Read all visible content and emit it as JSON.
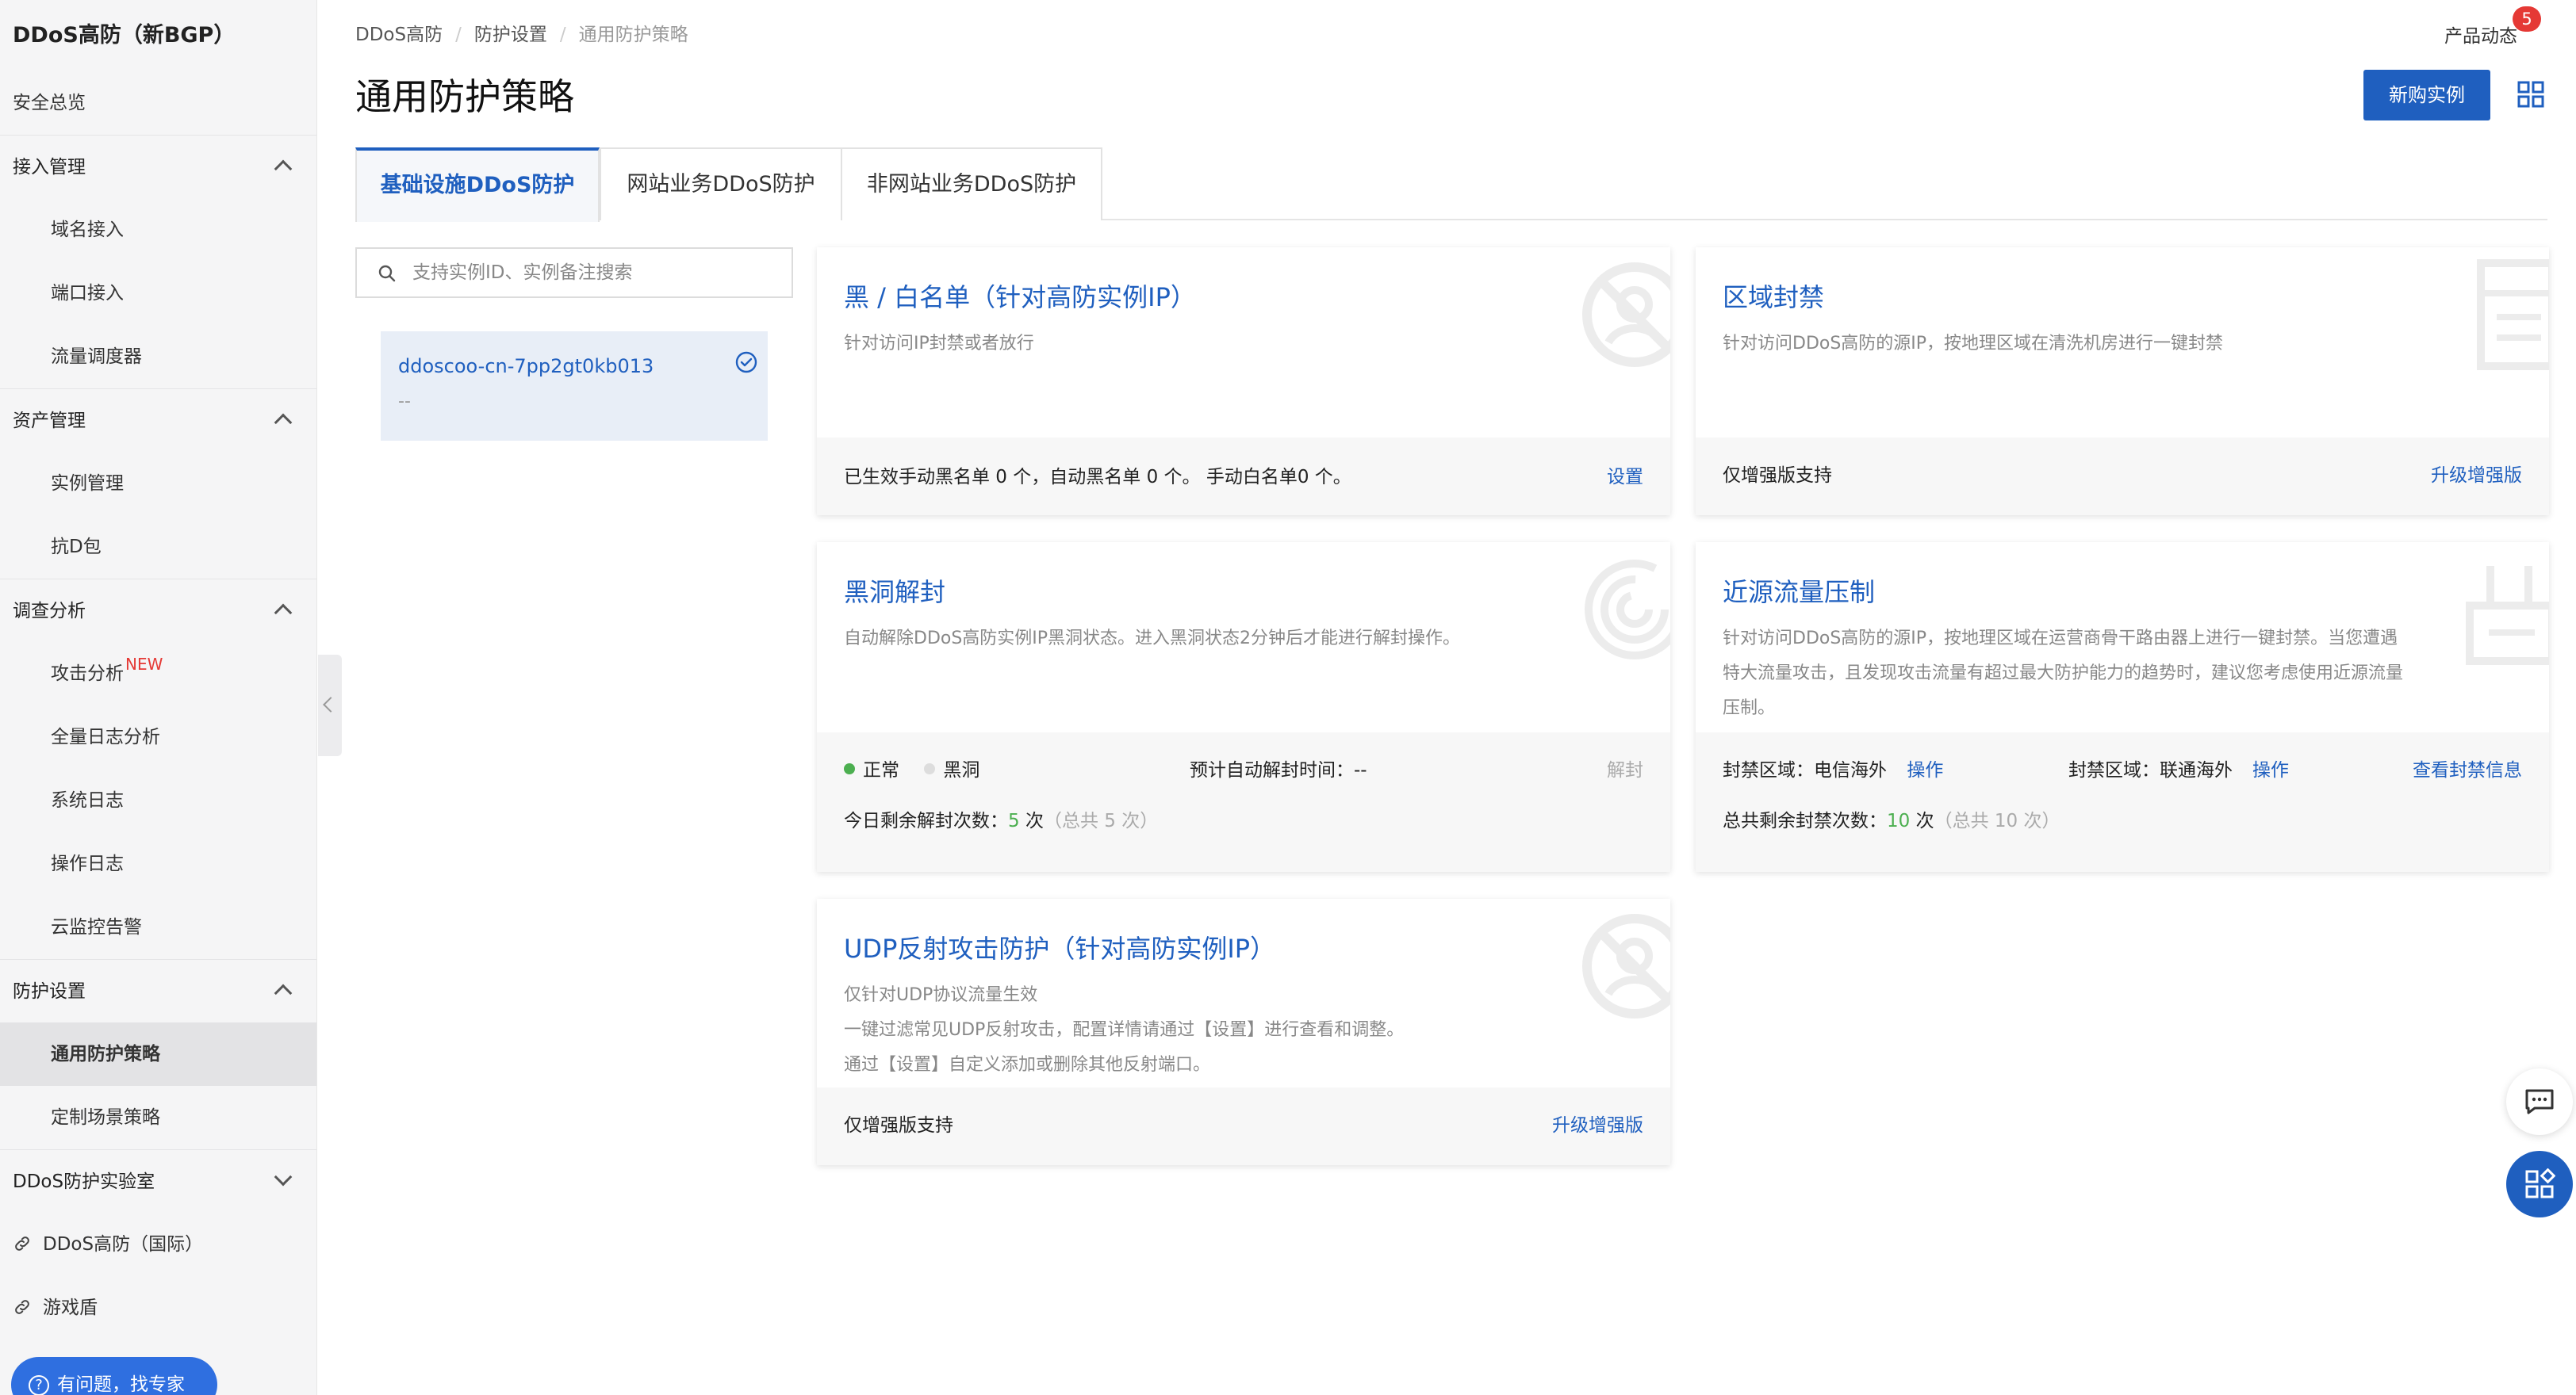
{
  "sidebar": {
    "brand": "DDoS高防（新BGP）",
    "overview": "安全总览",
    "groups": [
      {
        "label": "接入管理",
        "items": [
          "域名接入",
          "端口接入",
          "流量调度器"
        ]
      },
      {
        "label": "资产管理",
        "items": [
          "实例管理",
          "抗D包"
        ]
      },
      {
        "label": "调查分析",
        "items": [
          "攻击分析",
          "全量日志分析",
          "系统日志",
          "操作日志",
          "云监控告警"
        ]
      },
      {
        "label": "防护设置",
        "items": [
          "通用防护策略",
          "定制场景策略"
        ]
      },
      {
        "label": "DDoS防护实验室",
        "items": []
      }
    ],
    "new_badge": "NEW",
    "links": [
      "DDoS高防（国际）",
      "游戏盾"
    ],
    "help_button": "有问题，找专家"
  },
  "header": {
    "breadcrumb": [
      "DDoS高防",
      "防护设置",
      "通用防护策略"
    ],
    "title": "通用防护策略",
    "product_news": "产品动态",
    "news_count": "5",
    "buy_button": "新购实例"
  },
  "tabs": [
    "基础设施DDoS防护",
    "网站业务DDoS防护",
    "非网站业务DDoS防护"
  ],
  "search": {
    "placeholder": "支持实例ID、实例备注搜索"
  },
  "instance": {
    "id": "ddoscoo-cn-7pp2gt0kb013",
    "remark": "--"
  },
  "cards": {
    "blacklist": {
      "title": "黑 / 白名单（针对高防实例IP）",
      "desc": "针对访问IP封禁或者放行",
      "status": "已生效手动黑名单 0 个，自动黑名单 0 个。 手动白名单0 个。",
      "action": "设置"
    },
    "region": {
      "title": "区域封禁",
      "desc": "针对访问DDoS高防的源IP，按地理区域在清洗机房进行一键封禁",
      "note": "仅增强版支持",
      "action": "升级增强版"
    },
    "blackhole": {
      "title": "黑洞解封",
      "desc": "自动解除DDoS高防实例IP黑洞状态。进入黑洞状态2分钟后才能进行解封操作。",
      "legend_normal": "正常",
      "legend_blackhole": "黑洞",
      "auto_time_label": "预计自动解封时间：--",
      "unblock": "解封",
      "remain_label": "今日剩余解封次数：",
      "remain_value": "5",
      "remain_unit": "次",
      "remain_total": "（总共 5 次）"
    },
    "nearsource": {
      "title": "近源流量压制",
      "desc": "针对访问DDoS高防的源IP，按地理区域在运营商骨干路由器上进行一键封禁。当您遭遇特大流量攻击，且发现攻击流量有超过最大防护能力的趋势时，建议您考虑使用近源流量压制。",
      "area1_label": "封禁区域：电信海外",
      "area1_action": "操作",
      "area2_label": "封禁区域：联通海外",
      "area2_action": "操作",
      "view_info": "查看封禁信息",
      "remain_label": "总共剩余封禁次数：",
      "remain_value": "10",
      "remain_unit": "次",
      "remain_total": "（总共 10 次）"
    },
    "udp": {
      "title": "UDP反射攻击防护（针对高防实例IP）",
      "desc_lines": [
        "仅针对UDP协议流量生效",
        "一键过滤常见UDP反射攻击，配置详情请通过【设置】进行查看和调整。",
        "通过【设置】自定义添加或删除其他反射端口。"
      ],
      "note": "仅增强版支持",
      "action": "升级增强版"
    }
  },
  "colors": {
    "primary": "#1f5fbf",
    "green": "#4caf50",
    "badge": "#e53935"
  }
}
